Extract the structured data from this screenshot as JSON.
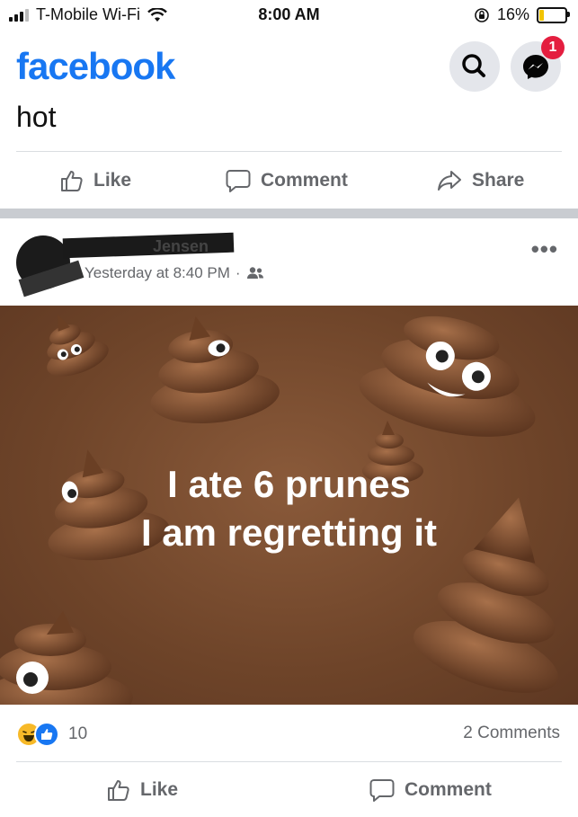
{
  "status": {
    "carrier": "T-Mobile Wi-Fi",
    "time": "8:00 AM",
    "battery": "16%",
    "battery_level": 0.16
  },
  "header": {
    "logo": "facebook",
    "messenger_badge": "1"
  },
  "post1": {
    "text": "hot",
    "actions": {
      "like": "Like",
      "comment": "Comment",
      "share": "Share"
    }
  },
  "post2": {
    "author": "Jensen",
    "timestamp": "Yesterday at 8:40 PM",
    "audience_separator": "·",
    "more": "•••",
    "image_text": [
      "I ate 6 prunes",
      "I am regretting it"
    ],
    "reaction_count": "10",
    "comments": "2 Comments",
    "actions": {
      "like": "Like",
      "comment": "Comment"
    }
  },
  "colors": {
    "brand": "#1877f2",
    "badge": "#e41e3f",
    "image_bg": "#6e4429",
    "muted": "#65676b"
  },
  "icons": [
    "wifi-icon",
    "search-icon",
    "messenger-icon",
    "like-icon",
    "comment-icon",
    "share-icon",
    "friends-icon",
    "haha-icon",
    "like-reaction-icon"
  ]
}
